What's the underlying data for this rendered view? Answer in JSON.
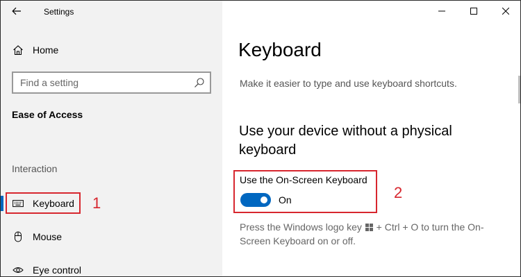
{
  "window": {
    "title": "Settings"
  },
  "sidebar": {
    "home_label": "Home",
    "search": {
      "placeholder": "Find a setting"
    },
    "section_heading": "Ease of Access",
    "group_label": "Interaction",
    "items": [
      {
        "label": "Keyboard",
        "icon": "keyboard-icon",
        "selected": true
      },
      {
        "label": "Mouse",
        "icon": "mouse-icon",
        "selected": false
      },
      {
        "label": "Eye control",
        "icon": "eye-icon",
        "selected": false
      }
    ]
  },
  "content": {
    "title": "Keyboard",
    "subtitle": "Make it easier to type and use keyboard shortcuts.",
    "section_heading": "Use your device without a physical keyboard",
    "on_screen_keyboard": {
      "label": "Use the On-Screen Keyboard",
      "state_label": "On",
      "enabled": true
    },
    "help_text_before": "Press the Windows logo key",
    "help_text_after": "+ Ctrl + O to turn the On-Screen Keyboard on or off."
  },
  "annotations": {
    "marker_1": "1",
    "marker_2": "2"
  },
  "colors": {
    "accent": "#0067c0",
    "annotation": "#d7262e",
    "sidebar_bg": "#f2f2f2"
  }
}
